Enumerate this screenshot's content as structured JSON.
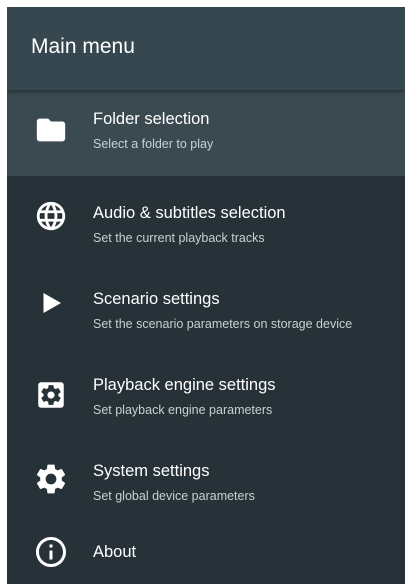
{
  "header": {
    "title": "Main menu"
  },
  "menu": {
    "items": [
      {
        "title": "Folder selection",
        "subtitle": "Select a folder to play",
        "icon": "folder-icon",
        "selected": true
      },
      {
        "title": "Audio & subtitles selection",
        "subtitle": "Set the current playback tracks",
        "icon": "globe-icon"
      },
      {
        "title": "Scenario settings",
        "subtitle": "Set the scenario parameters on storage device",
        "icon": "play-icon"
      },
      {
        "title": "Playback engine settings",
        "subtitle": "Set playback engine parameters",
        "icon": "gear-box-icon"
      },
      {
        "title": "System settings",
        "subtitle": "Set global device parameters",
        "icon": "gear-icon"
      },
      {
        "title": "About",
        "subtitle": "",
        "icon": "info-icon"
      }
    ]
  },
  "colors": {
    "background": "#263238",
    "header": "#36474f",
    "selected": "#3b4a51",
    "text": "#ffffff",
    "subtext": "#c9d0d3"
  }
}
